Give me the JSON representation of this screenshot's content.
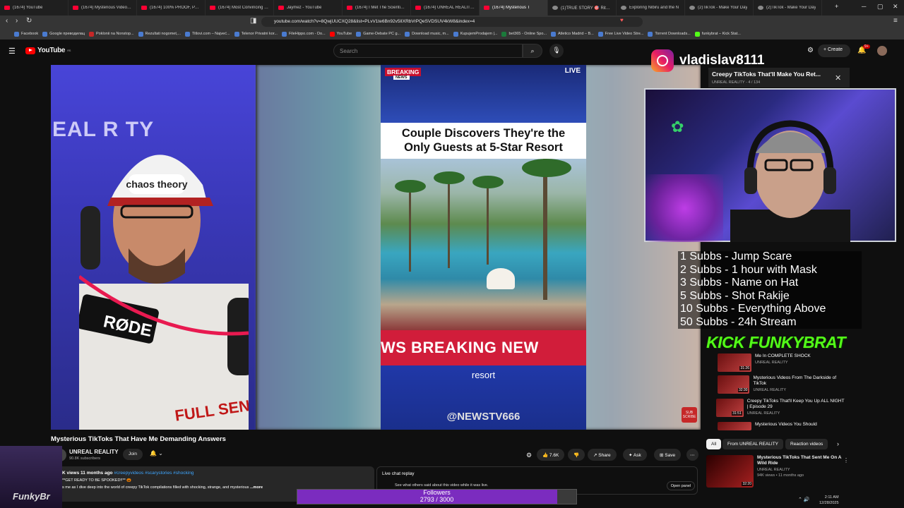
{
  "browser": {
    "tabs": [
      {
        "label": "(1674) YouTube",
        "active": false
      },
      {
        "label": "(1674) Mysterious Videos F",
        "active": false
      },
      {
        "label": "(1674) 100% PROOF, PARA",
        "active": false
      },
      {
        "label": "(1674) Most Convincing Ev",
        "active": false
      },
      {
        "label": "Jaymez - YouTube",
        "active": false
      },
      {
        "label": "(1674) I Met The Scientist T",
        "active": false
      },
      {
        "label": "(1674) UNREAL REALITY - Y",
        "active": false
      },
      {
        "label": "(1674) Mysterious T",
        "active": true
      },
      {
        "label": "(1)TRUE STORY 🎯 Ritonf",
        "active": false
      },
      {
        "label": "Exploring Nibiru and the N",
        "active": false
      },
      {
        "label": "(2)TikTok - Make Your Day",
        "active": false
      },
      {
        "label": "(2)TikTok - Make Your Day",
        "active": false
      }
    ],
    "url": "youtube.com/watch?v=8QwjUUCXQ28&list=PLvV1te6Bn92v5lIXRbVrPQeSVDSUV4kW8&index=4",
    "bookmarks": [
      "Facebook",
      "Google преводилац",
      "Poklonii na Nonstop...",
      "Rezultati nogomet,...",
      "Titlovi.com – Najveć...",
      "Telenor Privatni kor...",
      "FileHippo.com - Do...",
      "YouTube",
      "Game-Debate PC g...",
      "Download music, m...",
      "KupujemProdajem |...",
      "bet365 - Online Spo...",
      "Atletico Madrid – B...",
      "Free Live Video Stre...",
      "Torrent Downloads...",
      "funkybrat – Kick Stat..."
    ]
  },
  "youtube": {
    "logo": "YouTube",
    "logo_sup": "RS",
    "search_placeholder": "Search",
    "create_label": "Create",
    "notif_count": "9+"
  },
  "reel": {
    "breaking_tag": "BREAKING",
    "news_tag": "NEWS",
    "live_tag": "LIVE",
    "headline_line1": "Couple Discovers They're the",
    "headline_line2": "Only Guests at 5-Star Resort",
    "banner": "WS   BREAKING NEW",
    "caption": "resort",
    "handle": "@NEWSTV666"
  },
  "left_cam": {
    "bg_text": "EAL R  TY",
    "cap_text": "chaos theory",
    "mic_brand": "RØDE",
    "shirt_text": "FULL SEND"
  },
  "overlay": {
    "instagram_handle": "vladislav8111",
    "rewards": [
      "1 Subbs - Jump Scare",
      "2 Subbs - 1 hour with Mask",
      "3 Subbs - Name on Hat",
      "5 Subbs - Shot Rakije",
      "10 Subbs - Everything Above",
      "50 Subbs - 24h Stream"
    ],
    "kick_text": "KICK FUNKYBRAT",
    "followers_label": "Followers",
    "followers_count": "2793 / 3000",
    "followers_progress": 0.931,
    "bottom_left_brand": "FunkyBr"
  },
  "playlist": {
    "title": "Creepy TikToks That'll Make You Ret...",
    "subtitle": "UNREAL REALITY - 4 / 134",
    "items": [
      {
        "num": "",
        "title": "Me In COMPLETE SHOCK",
        "channel": "UNREAL REALITY",
        "duration": "31:26"
      },
      {
        "num": "",
        "title": "Mysterious Videos From The Darkside of TikTok",
        "channel": "UNREAL REALITY",
        "duration": "32:30"
      },
      {
        "num": "",
        "title": "Creepy TikToks That'll Keep You Up ALL NIGHT | Episode 29",
        "channel": "UNREAL REALITY",
        "duration": "31:51"
      },
      {
        "num": "",
        "title": "Mysterious Videos You Should",
        "channel": "",
        "duration": ""
      }
    ]
  },
  "video": {
    "title": "Mysterious TikToks That Have Me Demanding Answers",
    "channel": "UNREAL REALITY",
    "subscribers": "90.8K subscribers",
    "join_label": "Join",
    "likes": "7.6K",
    "share_label": "Share",
    "ask_label": "Ask",
    "save_label": "Save",
    "views_line": "K views  11 months ago",
    "hashtags": "#creepyvideos #scarystories #shocking",
    "desc_line1": "**GET READY TO BE SPOOKED!!** 🎃",
    "desc_line2": "s me as I dive deep into the world of creepy TikTok compilations filled with shocking, strange, and mysterious",
    "desc_more": "...more"
  },
  "chat": {
    "title": "Live chat replay",
    "subtitle": "See what others said about this video while it was live.",
    "open_panel": "Open panel"
  },
  "chips": [
    "All",
    "From UNREAL REALITY",
    "Reaction videos"
  ],
  "recommendation": {
    "title": "Mysterious TikToks That Sent Me On A Wild Ride",
    "channel": "UNREAL REALITY",
    "meta": "94K views • 11 months ago",
    "duration": "32:20"
  },
  "tray": {
    "time": "2:11 AM",
    "date": "12/28/2025"
  },
  "colors": {
    "youtube_red": "#ff0000",
    "kick_green": "#53fc18",
    "followers_bar": "#7b2cbf",
    "breaking_red": "#d11d3a"
  }
}
